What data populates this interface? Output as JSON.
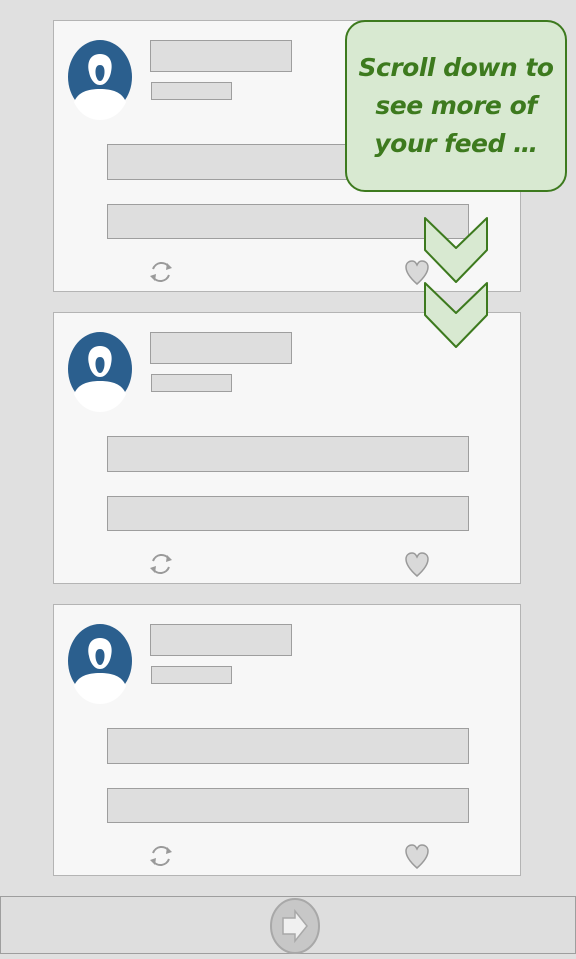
{
  "feed": {
    "posts": [
      {
        "id": "post-1"
      },
      {
        "id": "post-2"
      },
      {
        "id": "post-3"
      }
    ]
  },
  "icons": {
    "avatar": "user-avatar-icon",
    "repost": "repost-icon",
    "like": "heart-icon",
    "next": "arrow-right-icon",
    "scroll": "chevron-down-icon"
  },
  "callout": {
    "text": "Scroll down to see more of your feed …"
  },
  "colors": {
    "background": "#e0e0e0",
    "card": "#f7f7f7",
    "placeholder": "#dedede",
    "avatar_blue": "#2b5f8e",
    "callout_fill": "#d8e9d1",
    "callout_green": "#3d7a1e"
  }
}
